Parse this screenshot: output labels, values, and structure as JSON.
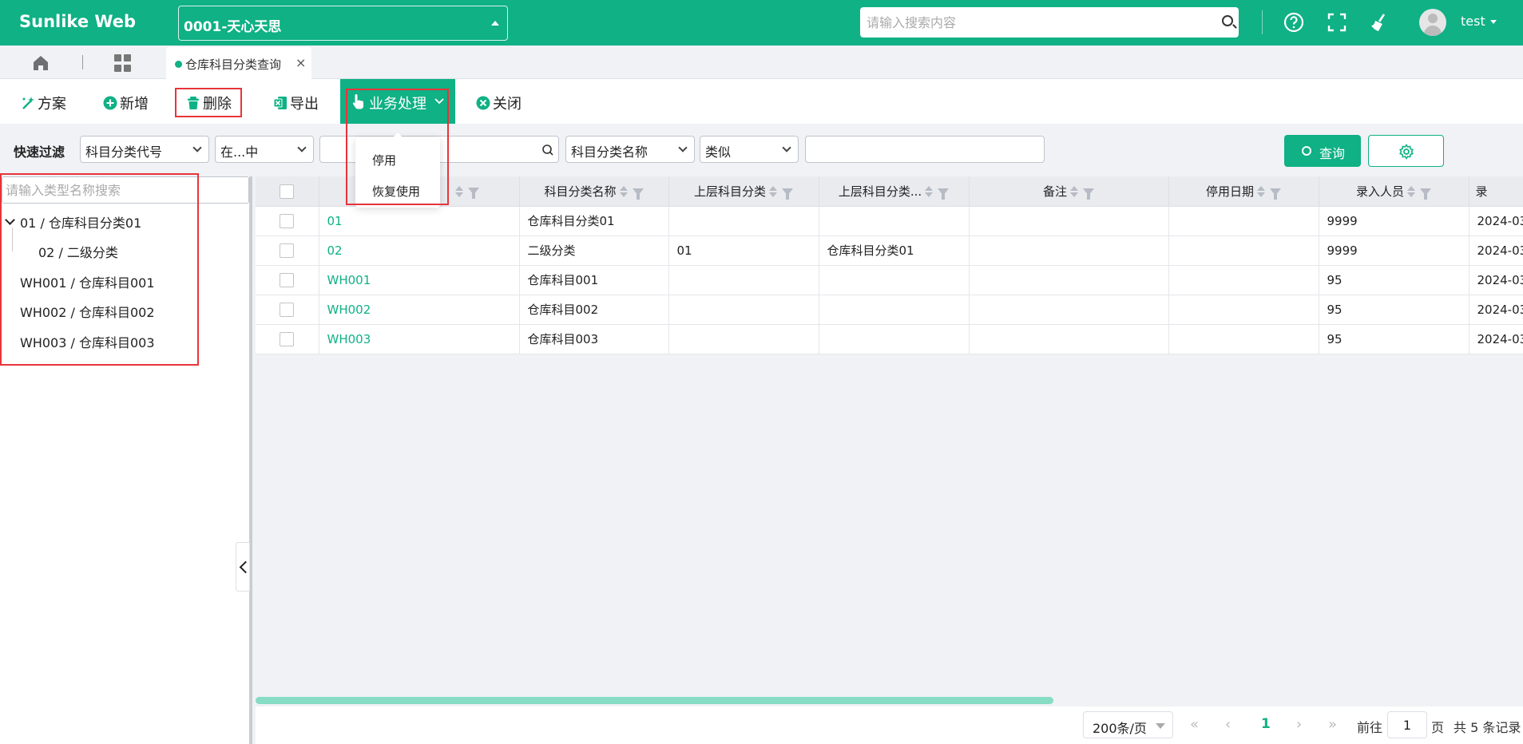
{
  "header": {
    "brand": "Sunlike Web",
    "org": "0001-天心天思",
    "search_placeholder": "请输入搜索内容",
    "user": "test",
    "accent": "#0fb185"
  },
  "tabs": {
    "active_label": "仓库科目分类查询",
    "close": "×"
  },
  "toolbar": {
    "plan": "方案",
    "add": "新增",
    "delete": "删除",
    "export": "导出",
    "business": "业务处理",
    "close": "关闭"
  },
  "dropdown": {
    "items": [
      "停用",
      "恢复使用"
    ]
  },
  "filter": {
    "label": "快速过滤",
    "field1": "科目分类代号",
    "op1": "在...中",
    "value1": "",
    "field2": "科目分类名称",
    "op2": "类似",
    "value2": "",
    "query": "查询"
  },
  "tree": {
    "search_placeholder": "请输入类型名称搜索",
    "items": [
      {
        "label": "01 / 仓库科目分类01"
      },
      {
        "label": "02 / 二级分类"
      },
      {
        "label": "WH001 / 仓库科目001"
      },
      {
        "label": "WH002 / 仓库科目002"
      },
      {
        "label": "WH003 / 仓库科目003"
      }
    ]
  },
  "table": {
    "columns": [
      "",
      "",
      "科目分类名称",
      "上层科目分类",
      "上层科目分类...",
      "备注",
      "停用日期",
      "录入人员",
      "录"
    ],
    "rows": [
      [
        "01",
        "仓库科目分类01",
        "",
        "",
        "",
        "",
        "9999",
        "2024-03"
      ],
      [
        "02",
        "二级分类",
        "01",
        "仓库科目分类01",
        "",
        "",
        "9999",
        "2024-03"
      ],
      [
        "WH001",
        "仓库科目001",
        "",
        "",
        "",
        "",
        "95",
        "2024-03"
      ],
      [
        "WH002",
        "仓库科目002",
        "",
        "",
        "",
        "",
        "95",
        "2024-03"
      ],
      [
        "WH003",
        "仓库科目003",
        "",
        "",
        "",
        "",
        "95",
        "2024-03"
      ]
    ]
  },
  "pager": {
    "page_size": "200条/页",
    "first": "«",
    "prev": "‹",
    "current": "1",
    "next": "›",
    "last": "»",
    "goto_label": "前往",
    "goto_value": "1",
    "page_suffix": "页",
    "total": "共 5 条记录"
  }
}
